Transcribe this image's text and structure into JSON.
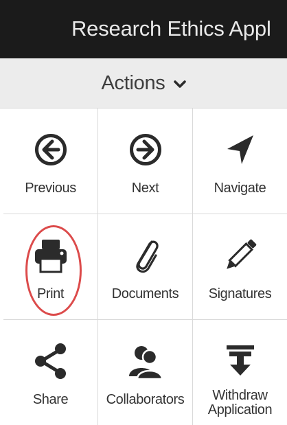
{
  "header": {
    "title": "Research Ethics Appl"
  },
  "actions_menu": {
    "label": "Actions",
    "chevron_icon": "chevron-down-icon"
  },
  "tiles": [
    {
      "label": "Previous",
      "icon": "arrow-circle-left-icon"
    },
    {
      "label": "Next",
      "icon": "arrow-circle-right-icon"
    },
    {
      "label": "Navigate",
      "icon": "location-arrow-icon"
    },
    {
      "label": "Print",
      "icon": "printer-icon"
    },
    {
      "label": "Documents",
      "icon": "paperclip-icon"
    },
    {
      "label": "Signatures",
      "icon": "pencil-icon"
    },
    {
      "label": "Share",
      "icon": "share-icon"
    },
    {
      "label": "Collaborators",
      "icon": "users-icon"
    },
    {
      "label": "Withdraw Application",
      "icon": "withdraw-icon"
    }
  ],
  "colors": {
    "header_bg": "#1b1b1b",
    "header_text": "#e9e9e9",
    "actions_bg": "#ececec",
    "icon": "#2b2b2b",
    "highlight": "#dc4b4b"
  }
}
